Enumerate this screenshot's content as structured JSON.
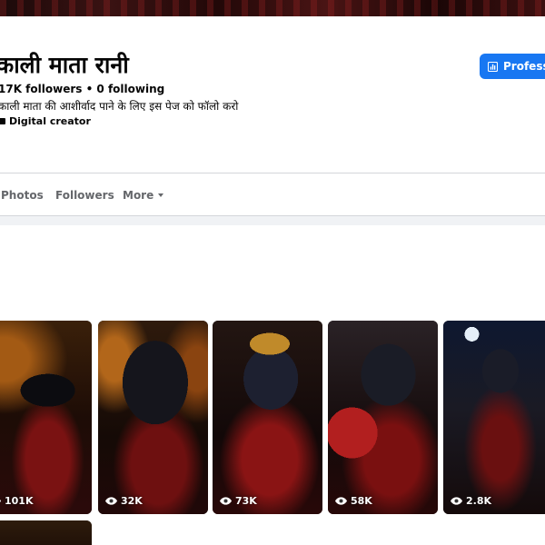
{
  "page": {
    "name": "काली माता रानी",
    "stats": "17K followers • 0 following",
    "bio": "काली माता की आशीर्वाद पाने के लिए इस पेज को फॉलो करो",
    "category": "Digital creator"
  },
  "actions": {
    "professional_label": "Professional dashboard"
  },
  "tabs": [
    {
      "label": "Photos"
    },
    {
      "label": "Followers"
    },
    {
      "label": "More"
    }
  ],
  "reels": [
    {
      "views": "101K"
    },
    {
      "views": "32K"
    },
    {
      "views": "73K"
    },
    {
      "views": "58K"
    },
    {
      "views": "2.8K"
    },
    {
      "views": ""
    }
  ],
  "colors": {
    "accent": "#1877f2",
    "text_primary": "#050505",
    "text_secondary": "#65676b"
  }
}
